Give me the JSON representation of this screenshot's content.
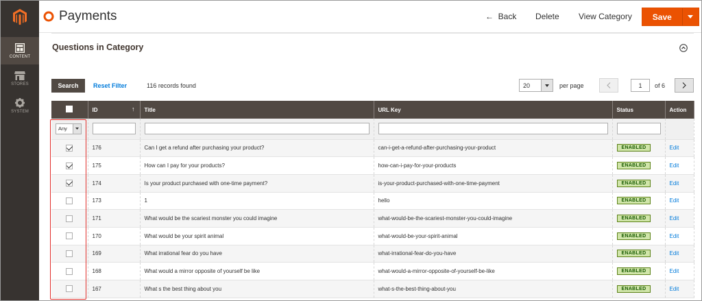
{
  "nav": {
    "items": [
      {
        "label": "CONTENT",
        "icon": "content-icon"
      },
      {
        "label": "STORES",
        "icon": "stores-icon"
      },
      {
        "label": "SYSTEM",
        "icon": "system-icon"
      }
    ]
  },
  "header": {
    "title": "Payments",
    "back": "Back",
    "delete": "Delete",
    "view_category": "View Category",
    "save": "Save"
  },
  "section": {
    "title": "Questions in Category"
  },
  "toolbar": {
    "search": "Search",
    "reset_filter": "Reset Filter",
    "records": "116 records found",
    "per_page_value": "20",
    "per_page_label": "per page",
    "current_page": "1",
    "of_pages": "of 6"
  },
  "grid": {
    "columns": [
      "ID",
      "Title",
      "URL Key",
      "Status",
      "Action"
    ],
    "filter_any": "Any",
    "rows": [
      {
        "checked": true,
        "id": "176",
        "title": "Can I get a refund after purchasing your product?",
        "url": "can-i-get-a-refund-after-purchasing-your-product",
        "status": "ENABLED",
        "action": "Edit"
      },
      {
        "checked": true,
        "id": "175",
        "title": "How can I pay for your products?",
        "url": "how-can-i-pay-for-your-products",
        "status": "ENABLED",
        "action": "Edit"
      },
      {
        "checked": true,
        "id": "174",
        "title": "Is your product purchased with one-time payment?",
        "url": "is-your-product-purchased-with-one-time-payment",
        "status": "ENABLED",
        "action": "Edit"
      },
      {
        "checked": false,
        "id": "173",
        "title": "1",
        "url": "hello",
        "status": "ENABLED",
        "action": "Edit"
      },
      {
        "checked": false,
        "id": "171",
        "title": "What would be the scariest monster you could imagine",
        "url": "what-would-be-the-scariest-monster-you-could-imagine",
        "status": "ENABLED",
        "action": "Edit"
      },
      {
        "checked": false,
        "id": "170",
        "title": "What would be your spirit animal",
        "url": "what-would-be-your-spirit-animal",
        "status": "ENABLED",
        "action": "Edit"
      },
      {
        "checked": false,
        "id": "169",
        "title": "What irrational fear do you have",
        "url": "what-irrational-fear-do-you-have",
        "status": "ENABLED",
        "action": "Edit"
      },
      {
        "checked": false,
        "id": "168",
        "title": "What would a mirror opposite of yourself be like",
        "url": "what-would-a-mirror-opposite-of-yourself-be-like",
        "status": "ENABLED",
        "action": "Edit"
      },
      {
        "checked": false,
        "id": "167",
        "title": "What s the best thing about you",
        "url": "what-s-the-best-thing-about-you",
        "status": "ENABLED",
        "action": "Edit"
      }
    ]
  },
  "colors": {
    "accent": "#eb5202",
    "sidebar": "#373330",
    "grid_header": "#514943",
    "link": "#007bdb",
    "badge_bg": "#d0e5a9",
    "badge_text": "#185b00",
    "highlight": "#e02b27"
  }
}
